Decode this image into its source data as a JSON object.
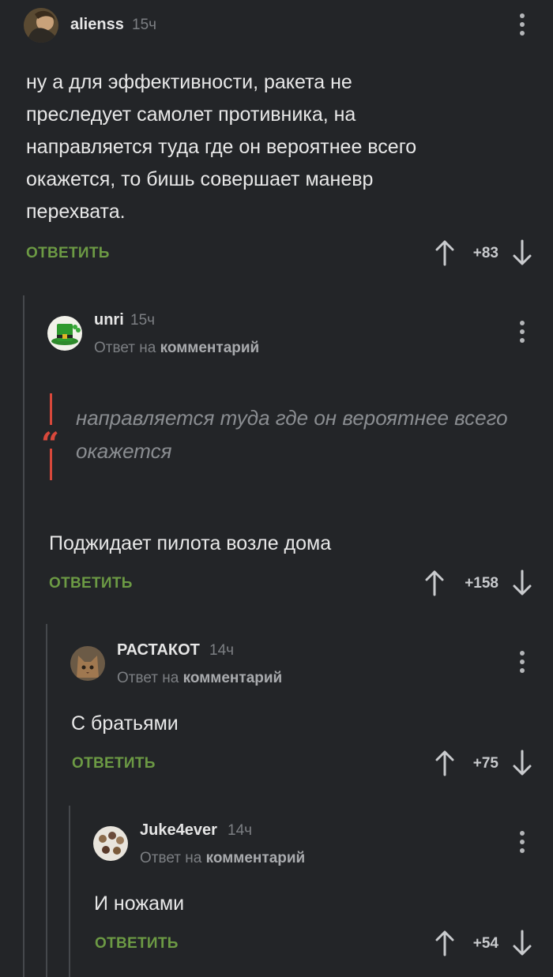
{
  "comments": [
    {
      "username": "alienss",
      "time": "15ч",
      "text": "ну а для эффективности, ракета не преследует самолет противника, на направляется туда где он вероятнее всего окажется, то бишь совершает маневр перехвата.",
      "reply_label": "ОТВЕТИТЬ",
      "score": "+83"
    },
    {
      "username": "unri",
      "time": "15ч",
      "reply_prefix": "Ответ на ",
      "reply_target": "комментарий",
      "quote": "направляется туда где он вероятнее всего окажется",
      "text": "Поджидает пилота возле дома",
      "reply_label": "ОТВЕТИТЬ",
      "score": "+158"
    },
    {
      "username": "РАСТАКОТ",
      "time": "14ч",
      "reply_prefix": "Ответ на ",
      "reply_target": "комментарий",
      "text": "С братьями",
      "reply_label": "ОТВЕТИТЬ",
      "score": "+75"
    },
    {
      "username": "Juke4ever",
      "time": "14ч",
      "reply_prefix": "Ответ на ",
      "reply_target": "комментарий",
      "text": "И ножами",
      "reply_label": "ОТВЕТИТЬ",
      "score": "+54"
    }
  ],
  "colors": {
    "background": "#232528",
    "reply_button": "#6c9a44",
    "quote_accent": "#d8483b"
  },
  "icons": [
    "more-vertical-icon",
    "arrow-up-icon",
    "arrow-down-icon",
    "quote-icon"
  ]
}
